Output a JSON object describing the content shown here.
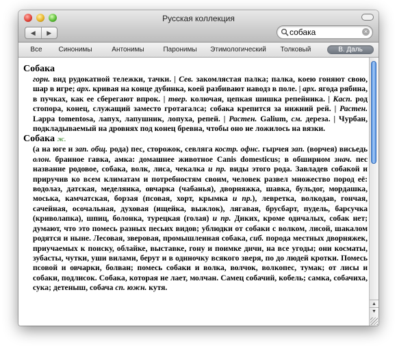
{
  "window": {
    "title": "Русская коллекция"
  },
  "navigation": {
    "back_label": "◀",
    "forward_label": "▶"
  },
  "search": {
    "value": "собака",
    "placeholder": ""
  },
  "tabs": [
    {
      "label": "Все",
      "active": false
    },
    {
      "label": "Синонимы",
      "active": false
    },
    {
      "label": "Антонимы",
      "active": false
    },
    {
      "label": "Паронимы",
      "active": false
    },
    {
      "label": "Этимологический",
      "active": false
    },
    {
      "label": "Толковый",
      "active": false
    },
    {
      "label": "В. Даль",
      "active": true
    }
  ],
  "entries": [
    {
      "headword": "Собака",
      "grammar": "",
      "segments": [
        {
          "t": "горн.",
          "i": true
        },
        {
          "t": " вид рудокатной тележки, тачки. | "
        },
        {
          "t": "Сев.",
          "i": true
        },
        {
          "t": " закомлястая палка; палка, коею гоняют свою, шар в игре; "
        },
        {
          "t": "арх.",
          "i": true
        },
        {
          "t": " кривая на конце дубинка, коей разбивают наводз в поле. | "
        },
        {
          "t": "арх.",
          "i": true
        },
        {
          "t": " ягода рябина, в пучках, как ее сберегают впрок. | "
        },
        {
          "t": "твер.",
          "i": true
        },
        {
          "t": " колючая, цепкая шишка репейника. | "
        },
        {
          "t": "Касп.",
          "i": true
        },
        {
          "t": " род стопора, конец, служащий заместо гротагалса; собака крепится за нижний рей. | "
        },
        {
          "t": "Растен.",
          "i": true
        },
        {
          "t": " Lappa tomentosa, лапух, лапушник, лопуха, репей. | "
        },
        {
          "t": "Растен.",
          "i": true
        },
        {
          "t": " Galium, "
        },
        {
          "t": "см.",
          "i": true
        },
        {
          "t": " дереза. | Чурбан, подкладываемый на дровнях под конец бревна, чтобы оно не ложилось на вязки."
        }
      ]
    },
    {
      "headword": "Собака",
      "grammar": "ж.",
      "segments": [
        {
          "t": "(а на юге и "
        },
        {
          "t": "зап. общ.",
          "i": true
        },
        {
          "t": " рода) пес, сторожок, севляга "
        },
        {
          "t": "костр. офнс.",
          "i": true
        },
        {
          "t": " гырчея "
        },
        {
          "t": "зап.",
          "i": true
        },
        {
          "t": " (ворчея) висьедь "
        },
        {
          "t": "олон.",
          "i": true
        },
        {
          "t": " бранное гавка, амка: домашнее животное Canis domesticus; в обширном "
        },
        {
          "t": "знач.",
          "i": true
        },
        {
          "t": " пес название родовое, собака, волк, лиса, чекалка "
        },
        {
          "t": "и пр.",
          "i": true
        },
        {
          "t": " виды этого рода. Завладев собакой и приручив ко всем климатам и потребностям своим, человек развел множество пород её: водолаз, датская, меделянка, овчарка (чабанья), дворняжка, шавка, бульдог, мордашка, моська, камчатская, борзая (псовая, хорт, крымка "
        },
        {
          "t": "и пр.",
          "i": true
        },
        {
          "t": "), левретка, волкодав, гончая, сачейная, осочальная, духовая (ищейка, выжлок), лягавая, брусбарт, пудель, барсучка (криволапка), шпиц, болонка, турецкая (голая) "
        },
        {
          "t": "и пр.",
          "i": true
        },
        {
          "t": " Диких, кроме одичалых, собак нет; думают, что это помесь разных песьих видов; ублюдки от собаки с волком, лисой, шакалом родятся и ныне. Лесовая, зверовая, промышленная собака, "
        },
        {
          "t": "сиб.",
          "i": true
        },
        {
          "t": " порода местных дворняжек, приучаемых к поиску, облайке, выставке, гону и поимке дичи, на все угоды; они косматы, зубасты, чутки, уши вилами, берут и в одиночку всякого зверя, по до людей кротки. Помесь псовой и овчарки, болван; помесь собаки и волка, волчок, волкопес, тумак; от лисы и собаки, подлисок. Собака, которая не лает, молчан. Самец собачий, кобель; самка, собачиха, сука; детеныш, собача "
        },
        {
          "t": "сп. южн.",
          "i": true
        },
        {
          "t": " кутя."
        }
      ]
    }
  ]
}
